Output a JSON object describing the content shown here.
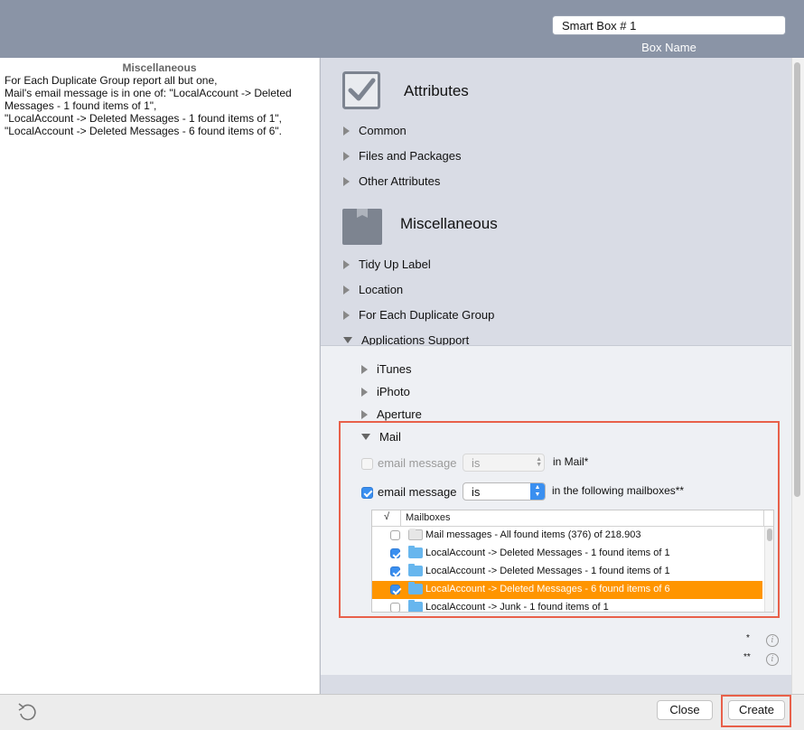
{
  "header": {
    "box_name_value": "Smart Box # 1",
    "box_name_label": "Box Name"
  },
  "left": {
    "title": "Miscellaneous",
    "description_lines": [
      "For Each Duplicate Group report all but one,",
      "Mail's email message is in one of: \"LocalAccount -> Deleted",
      "Messages - 1 found items of 1\",",
      "\"LocalAccount -> Deleted Messages - 1 found items of 1\",",
      "\"LocalAccount -> Deleted Messages - 6 found items of 6\"."
    ]
  },
  "attributes": {
    "title": "Attributes",
    "icon": "checkbox-icon",
    "items": [
      "Common",
      "Files and Packages",
      "Other Attributes"
    ]
  },
  "miscellaneous": {
    "title": "Miscellaneous",
    "icon": "box-icon",
    "items": [
      "Tidy Up Label",
      "Location",
      "For Each Duplicate Group",
      "Applications Support"
    ]
  },
  "app_support": {
    "items": [
      "iTunes",
      "iPhoto",
      "Aperture",
      "Mail"
    ]
  },
  "mail": {
    "row1": {
      "label": "email message",
      "op": "is",
      "suffix": "in Mail*",
      "checked": false,
      "enabled": false
    },
    "row2": {
      "label": "email message",
      "op": "is",
      "suffix": "in the following mailboxes**",
      "checked": true,
      "enabled": true
    },
    "table": {
      "check_header": "√",
      "name_header": "Mailboxes",
      "rows": [
        {
          "checked": false,
          "folder": "grey",
          "name": "Mail messages - All found items (376) of 218.903",
          "selected": false
        },
        {
          "checked": true,
          "folder": "blue",
          "name": "LocalAccount -> Deleted Messages - 1 found items of 1",
          "selected": false
        },
        {
          "checked": true,
          "folder": "blue",
          "name": "LocalAccount -> Deleted Messages - 1 found items of 1",
          "selected": false
        },
        {
          "checked": true,
          "folder": "blue",
          "name": "LocalAccount -> Deleted Messages - 6 found items of 6",
          "selected": true
        },
        {
          "checked": false,
          "folder": "blue",
          "name": "LocalAccount -> Junk - 1 found items of 1",
          "selected": false
        }
      ]
    }
  },
  "footnotes": {
    "one": "*",
    "two": "**"
  },
  "buttons": {
    "close": "Close",
    "create": "Create"
  },
  "colors": {
    "accent": "#3a8ff0",
    "selection": "#ff9500",
    "highlight": "#e8604a",
    "header": "#8a94a6"
  }
}
